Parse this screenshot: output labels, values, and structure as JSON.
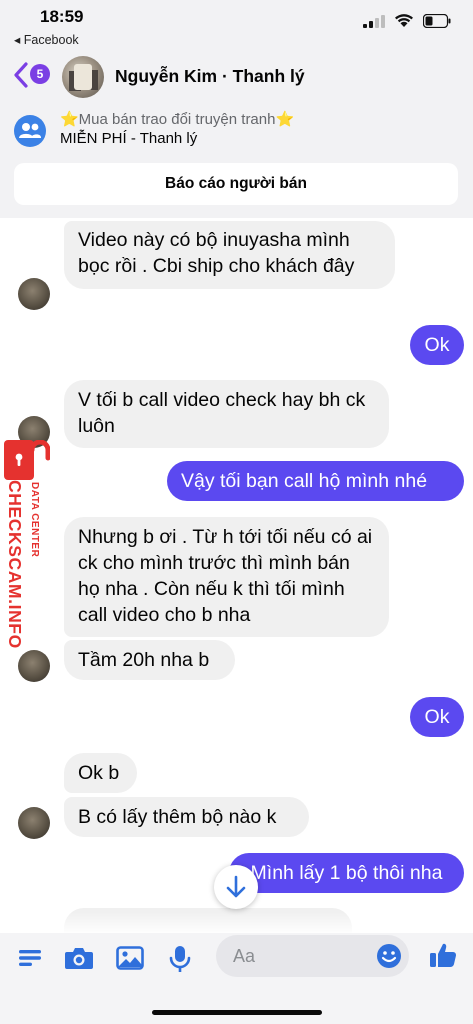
{
  "status_bar": {
    "time": "18:59",
    "back_app": "◂ Facebook"
  },
  "header": {
    "unread_count": "5",
    "title": "Nguyễn Kim · Thanh lý"
  },
  "group": {
    "line1": "⭐Mua bán trao đổi truyện tranh⭐",
    "line2": "MIỄN PHÍ - Thanh lý",
    "report_label": "Báo cáo người bán"
  },
  "messages": [
    {
      "dir": "in",
      "text": "Video này có bộ inuyasha mình bọc rồi . Cbi ship cho khách đây"
    },
    {
      "dir": "out",
      "text": "Ok"
    },
    {
      "dir": "in",
      "text": "V tối b call video check hay bh ck luôn"
    },
    {
      "dir": "out",
      "text": "Vậy tối bạn call hộ mình nhé"
    },
    {
      "dir": "in",
      "text": "Nhưng b ơi . Từ h tới tối nếu có ai ck cho mình trước thì mình bán họ nha . Còn nếu k thì tối mình call video cho b nha"
    },
    {
      "dir": "in",
      "text": "Tầm 20h nha b"
    },
    {
      "dir": "out",
      "text": "Ok"
    },
    {
      "dir": "in",
      "text": "Ok b"
    },
    {
      "dir": "in",
      "text": "B có lấy thêm bộ nào k"
    },
    {
      "dir": "out",
      "text": "Mình lấy 1 bộ thôi nha"
    }
  ],
  "watermark": {
    "small": "DATA CENTER",
    "big": "CHECKSCAM.INFO",
    "color": "#e5322f"
  },
  "composer": {
    "placeholder": "Aa"
  },
  "colors": {
    "accent": "#5b49f0",
    "incoming": "#f0f0f0",
    "icon_blue": "#2f6fdb"
  }
}
